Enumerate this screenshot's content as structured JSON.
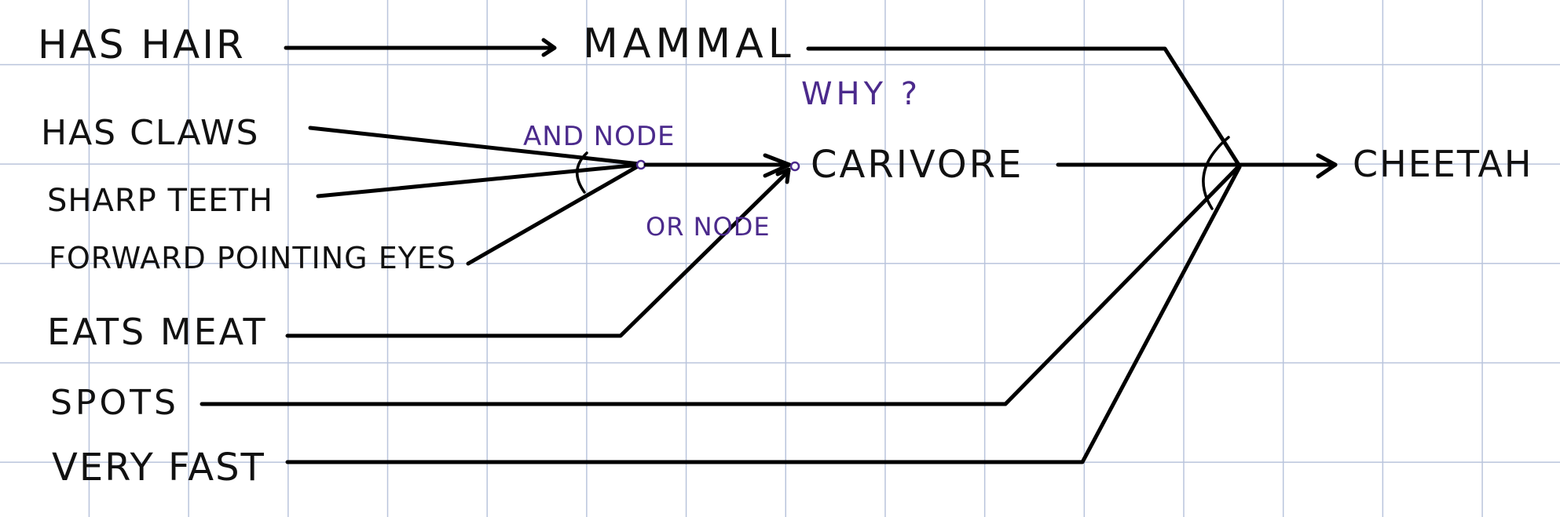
{
  "colors": {
    "ink": "#111111",
    "annotation": "#4b2a8c",
    "grid": "#b9c4dc"
  },
  "facts": {
    "has_hair": "HAS HAIR",
    "has_claws": "HAS CLAWS",
    "sharp_teeth": "SHARP TEETH",
    "forward_pointing_eyes": "FORWARD POINTING EYES",
    "eats_meat": "EATS MEAT",
    "spots": "SPOTS",
    "very_fast": "VERY FAST"
  },
  "conclusions": {
    "mammal": "MAMMAL",
    "carnivore": "CARIVORE",
    "cheetah": "CHEETAH"
  },
  "annotations": {
    "why": "WHY ?",
    "and_node": "AND NODE",
    "or_node": "OR NODE"
  }
}
